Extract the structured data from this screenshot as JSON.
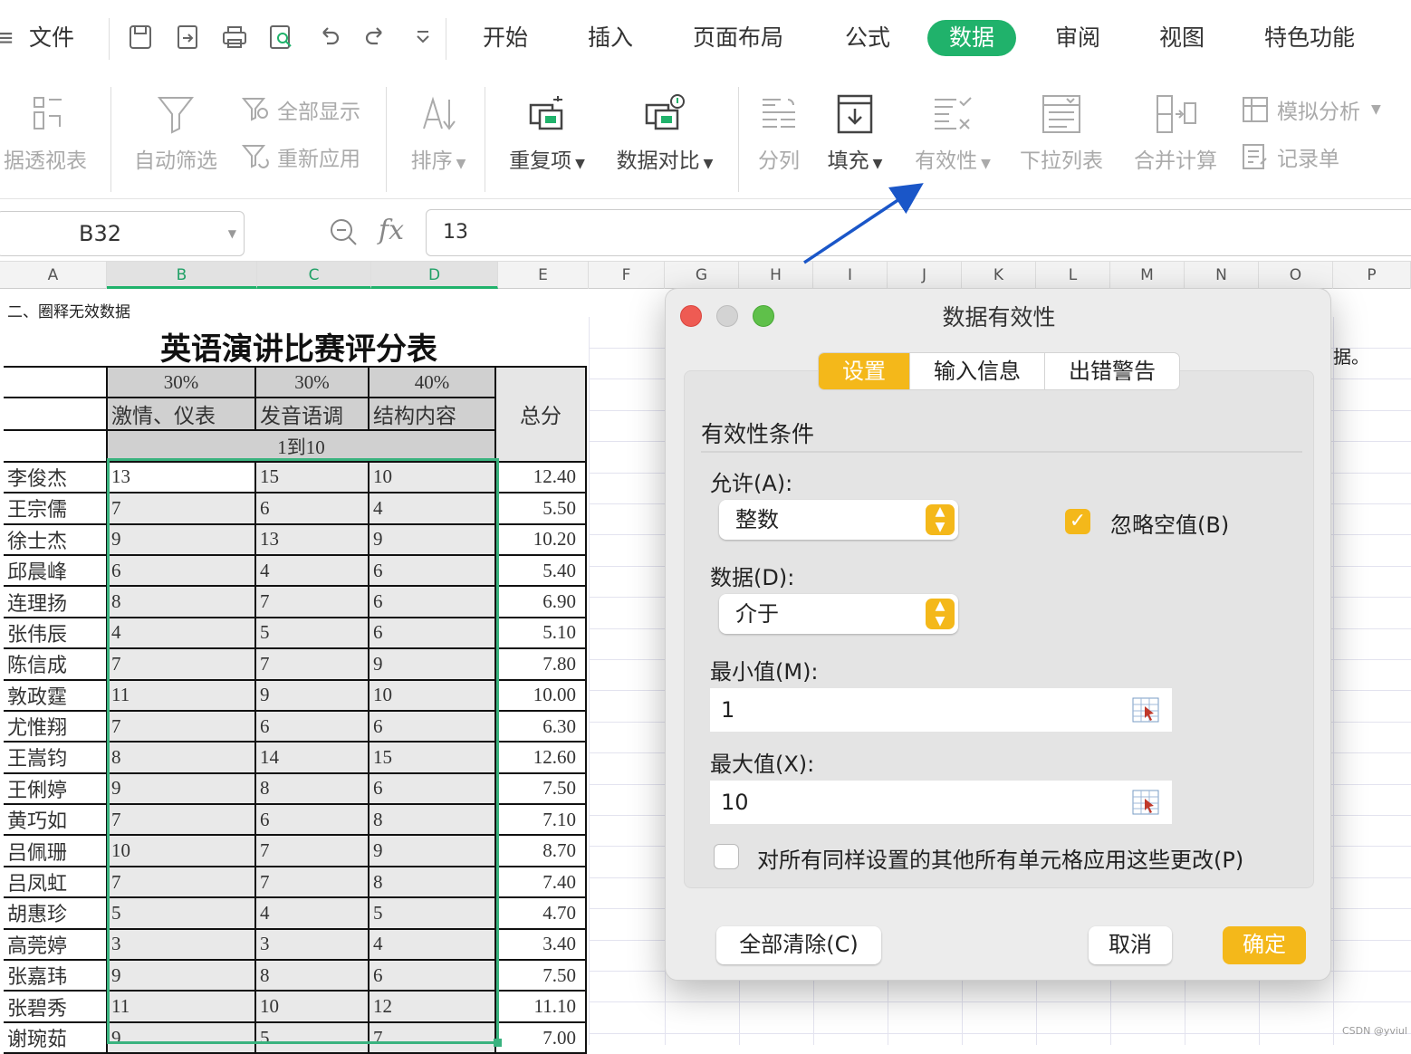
{
  "menubar": {
    "menu_glyph": "≡",
    "file": "文件",
    "tabs": [
      {
        "label": "开始"
      },
      {
        "label": "插入"
      },
      {
        "label": "页面布局"
      },
      {
        "label": "公式"
      },
      {
        "label": "数据"
      },
      {
        "label": "审阅"
      },
      {
        "label": "视图"
      },
      {
        "label": "特色功能"
      }
    ],
    "active_tab": "数据",
    "active_color": "#20b26b"
  },
  "ribbon": {
    "pivot": "据透视表",
    "autofilter": "自动筛选",
    "show_all": "全部显示",
    "reapply": "重新应用",
    "sort": "排序",
    "duplicates": "重复项",
    "compare": "数据对比",
    "split": "分列",
    "fill": "填充",
    "validation": "有效性",
    "dropdown_list": "下拉列表",
    "consolidate": "合并计算",
    "what_if": "模拟分析",
    "record_form": "记录单"
  },
  "formula_bar": {
    "cell_ref": "B32",
    "fx": "fx",
    "value": "13"
  },
  "columns": [
    "A",
    "B",
    "C",
    "D",
    "E",
    "F",
    "G",
    "H",
    "I",
    "J",
    "K",
    "L",
    "M",
    "N",
    "O",
    "P"
  ],
  "sheet": {
    "section_label": "二、圈释无效数据",
    "title": "英语演讲比赛评分表",
    "weights": [
      "30%",
      "30%",
      "40%"
    ],
    "criteria": [
      "激情、仪表",
      "发音语调",
      "结构内容"
    ],
    "total_header": "总分",
    "range_note": "1到10",
    "rows": [
      {
        "name": "李俊杰",
        "b": "13",
        "c": "15",
        "d": "10",
        "total": "12.40"
      },
      {
        "name": "王宗儒",
        "b": "7",
        "c": "6",
        "d": "4",
        "total": "5.50"
      },
      {
        "name": "徐士杰",
        "b": "9",
        "c": "13",
        "d": "9",
        "total": "10.20"
      },
      {
        "name": "邱晨峰",
        "b": "6",
        "c": "4",
        "d": "6",
        "total": "5.40"
      },
      {
        "name": "连理扬",
        "b": "8",
        "c": "7",
        "d": "6",
        "total": "6.90"
      },
      {
        "name": "张伟辰",
        "b": "4",
        "c": "5",
        "d": "6",
        "total": "5.10"
      },
      {
        "name": "陈信成",
        "b": "7",
        "c": "7",
        "d": "9",
        "total": "7.80"
      },
      {
        "name": "敦政霆",
        "b": "11",
        "c": "9",
        "d": "10",
        "total": "10.00"
      },
      {
        "name": "尤惟翔",
        "b": "7",
        "c": "6",
        "d": "6",
        "total": "6.30"
      },
      {
        "name": "王嵩钧",
        "b": "8",
        "c": "14",
        "d": "15",
        "total": "12.60"
      },
      {
        "name": "王俐婷",
        "b": "9",
        "c": "8",
        "d": "6",
        "total": "7.50"
      },
      {
        "name": "黄巧如",
        "b": "7",
        "c": "6",
        "d": "8",
        "total": "7.10"
      },
      {
        "name": "吕佩珊",
        "b": "10",
        "c": "7",
        "d": "9",
        "total": "8.70"
      },
      {
        "name": "吕凤虹",
        "b": "7",
        "c": "7",
        "d": "8",
        "total": "7.40"
      },
      {
        "name": "胡惠珍",
        "b": "5",
        "c": "4",
        "d": "5",
        "total": "4.70"
      },
      {
        "name": "高莞婷",
        "b": "3",
        "c": "3",
        "d": "4",
        "total": "3.40"
      },
      {
        "name": "张嘉玮",
        "b": "9",
        "c": "8",
        "d": "6",
        "total": "7.50"
      },
      {
        "name": "张碧秀",
        "b": "11",
        "c": "10",
        "d": "12",
        "total": "11.10"
      },
      {
        "name": "谢琬茹",
        "b": "9",
        "c": "5",
        "d": "7",
        "total": "7.00"
      }
    ],
    "peek_text": "据。",
    "selection_color": "#3ab37f"
  },
  "dialog": {
    "title": "数据有效性",
    "tabs": [
      "设置",
      "输入信息",
      "出错警告"
    ],
    "active_tab": "设置",
    "section_heading": "有效性条件",
    "allow_label": "允许(A):",
    "allow_value": "整数",
    "ignore_blank_label": "忽略空值(B)",
    "ignore_blank_checked": true,
    "data_label": "数据(D):",
    "data_value": "介于",
    "min_label": "最小值(M):",
    "min_value": "1",
    "max_label": "最大值(X):",
    "max_value": "10",
    "apply_all_label": "对所有同样设置的其他所有单元格应用这些更改(P)",
    "apply_all_checked": false,
    "clear_all": "全部清除(C)",
    "cancel": "取消",
    "ok": "确定",
    "accent_color": "#f4b81a"
  },
  "watermark": "CSDN @yviul",
  "annotation_color": "#1a56c8"
}
